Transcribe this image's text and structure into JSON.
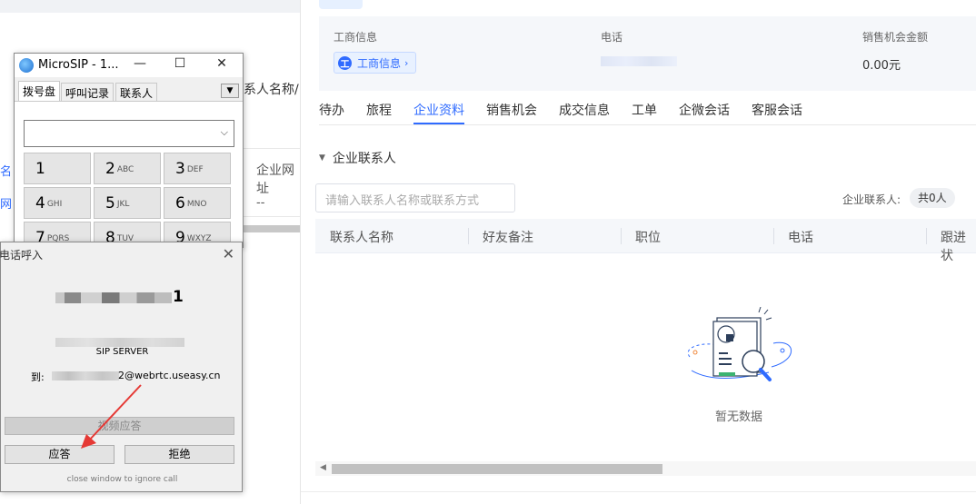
{
  "bg_left": {
    "col_header": "系人名称/",
    "header2": "企业网址",
    "cell_dash": "--",
    "link_fragment": "网",
    "blue_fragment": "名"
  },
  "right": {
    "info": {
      "biz_label": "工商信息",
      "biz_button": "工商信息",
      "biz_icon_letter": "工",
      "phone_label": "电话",
      "amount_label": "销售机会金额",
      "amount_value": "0.00元"
    },
    "tabs": [
      "待办",
      "旅程",
      "企业资料",
      "销售机会",
      "成交信息",
      "工单",
      "企微会话",
      "客服会话"
    ],
    "active_tab": "企业资料",
    "section_title": "企业联系人",
    "search_placeholder": "请输入联系人名称或联系方式",
    "contact_count_label": "企业联系人:",
    "contact_count_value": "共0人",
    "table_headers": [
      "联系人名称",
      "好友备注",
      "职位",
      "电话",
      "跟进状"
    ],
    "empty_text": "暂无数据"
  },
  "microsip": {
    "title": "MicroSIP - 1...",
    "tabs": [
      "拨号盘",
      "呼叫记录",
      "联系人"
    ],
    "keys": [
      {
        "d": "1",
        "l": ""
      },
      {
        "d": "2",
        "l": "ABC"
      },
      {
        "d": "3",
        "l": "DEF"
      },
      {
        "d": "4",
        "l": "GHI"
      },
      {
        "d": "5",
        "l": "JKL"
      },
      {
        "d": "6",
        "l": "MNO"
      },
      {
        "d": "7",
        "l": "PQRS"
      },
      {
        "d": "8",
        "l": "TUV"
      },
      {
        "d": "9",
        "l": "WXYZ"
      }
    ]
  },
  "call_popup": {
    "title": "电话呼入",
    "caller_last_digit": "1",
    "server": "SIP SERVER",
    "to_label": "到:",
    "to_value": "2@webrtc.useasy.cn",
    "video_answer": "视频应答",
    "answer": "应答",
    "reject": "拒绝",
    "ignore_hint": "close window to ignore call"
  },
  "colors": {
    "accent": "#2f6bff",
    "arrow": "#e53935"
  },
  "icons": {
    "app": "microsip-app-icon",
    "empty": "empty-document-search-icon"
  }
}
